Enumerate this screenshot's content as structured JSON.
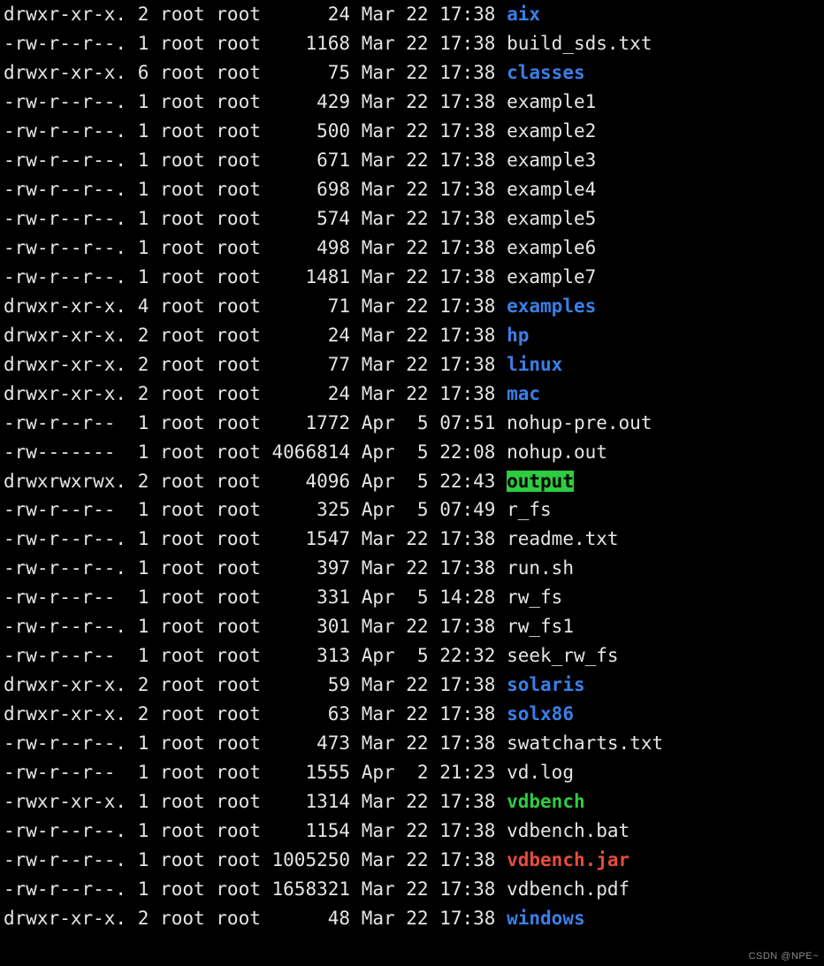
{
  "watermark": "CSDN @NPE~",
  "listing": [
    {
      "perms": "drwxr-xr-x.",
      "links": "2",
      "owner": "root",
      "group": "root",
      "size": "24",
      "month": "Mar",
      "day": "22",
      "time": "17:38",
      "name": "aix",
      "kind": "dir"
    },
    {
      "perms": "-rw-r--r--.",
      "links": "1",
      "owner": "root",
      "group": "root",
      "size": "1168",
      "month": "Mar",
      "day": "22",
      "time": "17:38",
      "name": "build_sds.txt",
      "kind": "file"
    },
    {
      "perms": "drwxr-xr-x.",
      "links": "6",
      "owner": "root",
      "group": "root",
      "size": "75",
      "month": "Mar",
      "day": "22",
      "time": "17:38",
      "name": "classes",
      "kind": "dir"
    },
    {
      "perms": "-rw-r--r--.",
      "links": "1",
      "owner": "root",
      "group": "root",
      "size": "429",
      "month": "Mar",
      "day": "22",
      "time": "17:38",
      "name": "example1",
      "kind": "file"
    },
    {
      "perms": "-rw-r--r--.",
      "links": "1",
      "owner": "root",
      "group": "root",
      "size": "500",
      "month": "Mar",
      "day": "22",
      "time": "17:38",
      "name": "example2",
      "kind": "file"
    },
    {
      "perms": "-rw-r--r--.",
      "links": "1",
      "owner": "root",
      "group": "root",
      "size": "671",
      "month": "Mar",
      "day": "22",
      "time": "17:38",
      "name": "example3",
      "kind": "file"
    },
    {
      "perms": "-rw-r--r--.",
      "links": "1",
      "owner": "root",
      "group": "root",
      "size": "698",
      "month": "Mar",
      "day": "22",
      "time": "17:38",
      "name": "example4",
      "kind": "file"
    },
    {
      "perms": "-rw-r--r--.",
      "links": "1",
      "owner": "root",
      "group": "root",
      "size": "574",
      "month": "Mar",
      "day": "22",
      "time": "17:38",
      "name": "example5",
      "kind": "file"
    },
    {
      "perms": "-rw-r--r--.",
      "links": "1",
      "owner": "root",
      "group": "root",
      "size": "498",
      "month": "Mar",
      "day": "22",
      "time": "17:38",
      "name": "example6",
      "kind": "file"
    },
    {
      "perms": "-rw-r--r--.",
      "links": "1",
      "owner": "root",
      "group": "root",
      "size": "1481",
      "month": "Mar",
      "day": "22",
      "time": "17:38",
      "name": "example7",
      "kind": "file"
    },
    {
      "perms": "drwxr-xr-x.",
      "links": "4",
      "owner": "root",
      "group": "root",
      "size": "71",
      "month": "Mar",
      "day": "22",
      "time": "17:38",
      "name": "examples",
      "kind": "dir"
    },
    {
      "perms": "drwxr-xr-x.",
      "links": "2",
      "owner": "root",
      "group": "root",
      "size": "24",
      "month": "Mar",
      "day": "22",
      "time": "17:38",
      "name": "hp",
      "kind": "dir"
    },
    {
      "perms": "drwxr-xr-x.",
      "links": "2",
      "owner": "root",
      "group": "root",
      "size": "77",
      "month": "Mar",
      "day": "22",
      "time": "17:38",
      "name": "linux",
      "kind": "dir"
    },
    {
      "perms": "drwxr-xr-x.",
      "links": "2",
      "owner": "root",
      "group": "root",
      "size": "24",
      "month": "Mar",
      "day": "22",
      "time": "17:38",
      "name": "mac",
      "kind": "dir"
    },
    {
      "perms": "-rw-r--r-- ",
      "links": "1",
      "owner": "root",
      "group": "root",
      "size": "1772",
      "month": "Apr",
      "day": " 5",
      "time": "07:51",
      "name": "nohup-pre.out",
      "kind": "file"
    },
    {
      "perms": "-rw------- ",
      "links": "1",
      "owner": "root",
      "group": "root",
      "size": "4066814",
      "month": "Apr",
      "day": " 5",
      "time": "22:08",
      "name": "nohup.out",
      "kind": "file"
    },
    {
      "perms": "drwxrwxrwx.",
      "links": "2",
      "owner": "root",
      "group": "root",
      "size": "4096",
      "month": "Apr",
      "day": " 5",
      "time": "22:43",
      "name": "output",
      "kind": "owhi"
    },
    {
      "perms": "-rw-r--r-- ",
      "links": "1",
      "owner": "root",
      "group": "root",
      "size": "325",
      "month": "Apr",
      "day": " 5",
      "time": "07:49",
      "name": "r_fs",
      "kind": "file"
    },
    {
      "perms": "-rw-r--r--.",
      "links": "1",
      "owner": "root",
      "group": "root",
      "size": "1547",
      "month": "Mar",
      "day": "22",
      "time": "17:38",
      "name": "readme.txt",
      "kind": "file"
    },
    {
      "perms": "-rw-r--r--.",
      "links": "1",
      "owner": "root",
      "group": "root",
      "size": "397",
      "month": "Mar",
      "day": "22",
      "time": "17:38",
      "name": "run.sh",
      "kind": "file"
    },
    {
      "perms": "-rw-r--r-- ",
      "links": "1",
      "owner": "root",
      "group": "root",
      "size": "331",
      "month": "Apr",
      "day": " 5",
      "time": "14:28",
      "name": "rw_fs",
      "kind": "file"
    },
    {
      "perms": "-rw-r--r--.",
      "links": "1",
      "owner": "root",
      "group": "root",
      "size": "301",
      "month": "Mar",
      "day": "22",
      "time": "17:38",
      "name": "rw_fs1",
      "kind": "file"
    },
    {
      "perms": "-rw-r--r-- ",
      "links": "1",
      "owner": "root",
      "group": "root",
      "size": "313",
      "month": "Apr",
      "day": " 5",
      "time": "22:32",
      "name": "seek_rw_fs",
      "kind": "file"
    },
    {
      "perms": "drwxr-xr-x.",
      "links": "2",
      "owner": "root",
      "group": "root",
      "size": "59",
      "month": "Mar",
      "day": "22",
      "time": "17:38",
      "name": "solaris",
      "kind": "dir"
    },
    {
      "perms": "drwxr-xr-x.",
      "links": "2",
      "owner": "root",
      "group": "root",
      "size": "63",
      "month": "Mar",
      "day": "22",
      "time": "17:38",
      "name": "solx86",
      "kind": "dir"
    },
    {
      "perms": "-rw-r--r--.",
      "links": "1",
      "owner": "root",
      "group": "root",
      "size": "473",
      "month": "Mar",
      "day": "22",
      "time": "17:38",
      "name": "swatcharts.txt",
      "kind": "file"
    },
    {
      "perms": "-rw-r--r-- ",
      "links": "1",
      "owner": "root",
      "group": "root",
      "size": "1555",
      "month": "Apr",
      "day": " 2",
      "time": "21:23",
      "name": "vd.log",
      "kind": "file"
    },
    {
      "perms": "-rwxr-xr-x.",
      "links": "1",
      "owner": "root",
      "group": "root",
      "size": "1314",
      "month": "Mar",
      "day": "22",
      "time": "17:38",
      "name": "vdbench",
      "kind": "exec"
    },
    {
      "perms": "-rw-r--r--.",
      "links": "1",
      "owner": "root",
      "group": "root",
      "size": "1154",
      "month": "Mar",
      "day": "22",
      "time": "17:38",
      "name": "vdbench.bat",
      "kind": "file"
    },
    {
      "perms": "-rw-r--r--.",
      "links": "1",
      "owner": "root",
      "group": "root",
      "size": "1005250",
      "month": "Mar",
      "day": "22",
      "time": "17:38",
      "name": "vdbench.jar",
      "kind": "jar"
    },
    {
      "perms": "-rw-r--r--.",
      "links": "1",
      "owner": "root",
      "group": "root",
      "size": "1658321",
      "month": "Mar",
      "day": "22",
      "time": "17:38",
      "name": "vdbench.pdf",
      "kind": "file"
    },
    {
      "perms": "drwxr-xr-x.",
      "links": "2",
      "owner": "root",
      "group": "root",
      "size": "48",
      "month": "Mar",
      "day": "22",
      "time": "17:38",
      "name": "windows",
      "kind": "dir"
    }
  ]
}
